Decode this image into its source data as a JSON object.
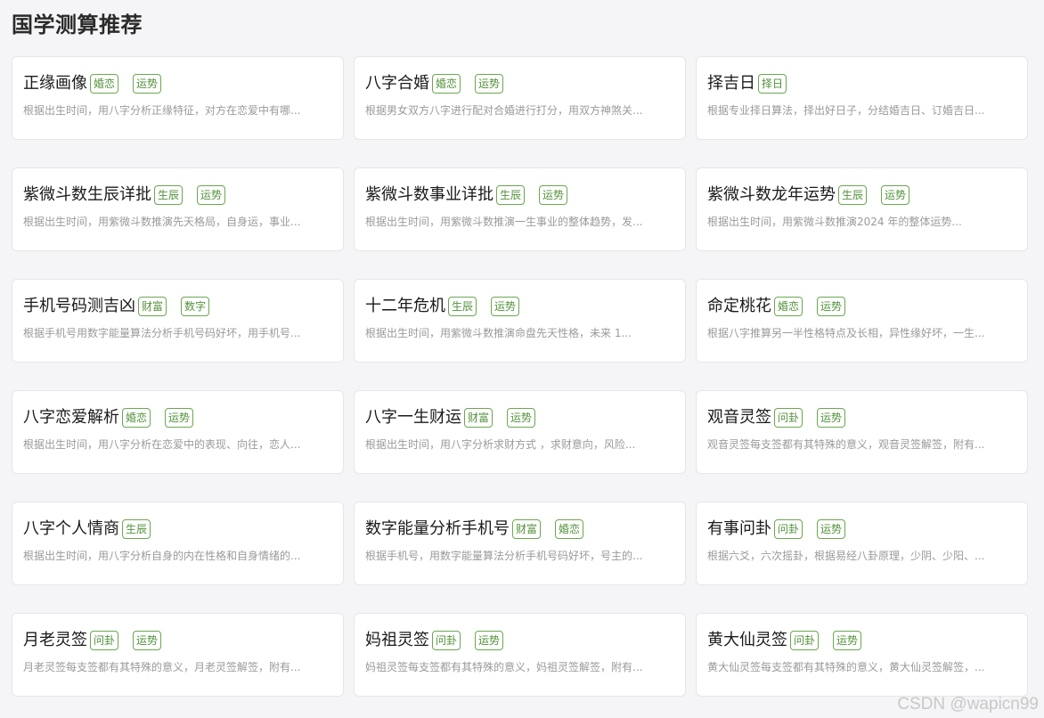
{
  "page": {
    "title": "国学测算推荐",
    "watermark": "CSDN @wapicn99"
  },
  "cards": [
    {
      "title": "正缘画像",
      "tags": [
        "婚恋",
        "运势"
      ],
      "desc": "根据出生时间，用八字分析正缘特征，对方在恋爱中有哪..."
    },
    {
      "title": "八字合婚",
      "tags": [
        "婚恋",
        "运势"
      ],
      "desc": "根据男女双方八字进行配对合婚进行打分，用双方神煞关..."
    },
    {
      "title": "择吉日",
      "tags": [
        "择日"
      ],
      "desc": "根据专业择日算法，择出好日子，分结婚吉日、订婚吉日..."
    },
    {
      "title": "紫微斗数生辰详批",
      "tags": [
        "生辰",
        "运势"
      ],
      "desc": "根据出生时间，用紫微斗数推演先天格局，自身运，事业..."
    },
    {
      "title": "紫微斗数事业详批",
      "tags": [
        "生辰",
        "运势"
      ],
      "desc": "根据出生时间，用紫微斗数推演一生事业的整体趋势，发..."
    },
    {
      "title": "紫微斗数龙年运势",
      "tags": [
        "生辰",
        "运势"
      ],
      "desc": "根据出生时间，用紫微斗数推演2024 年的整体运势..."
    },
    {
      "title": "手机号码测吉凶",
      "tags": [
        "财富",
        "数字"
      ],
      "desc": "根据手机号用数字能量算法分析手机号码好坏，用手机号..."
    },
    {
      "title": "十二年危机",
      "tags": [
        "生辰",
        "运势"
      ],
      "desc": "根据出生时间，用紫微斗数推演命盘先天性格，未来 1..."
    },
    {
      "title": "命定桃花",
      "tags": [
        "婚恋",
        "运势"
      ],
      "desc": "根据八字推算另一半性格特点及长相，异性缘好坏，一生..."
    },
    {
      "title": "八字恋爱解析",
      "tags": [
        "婚恋",
        "运势"
      ],
      "desc": "根据出生时间，用八字分析在恋爱中的表现、向往，恋人..."
    },
    {
      "title": "八字一生财运",
      "tags": [
        "财富",
        "运势"
      ],
      "desc": "根据出生时间，用八字分析求财方式 ，求财意向，风险..."
    },
    {
      "title": "观音灵签",
      "tags": [
        "问卦",
        "运势"
      ],
      "desc": "观音灵签每支签都有其特殊的意义，观音灵签解签，附有..."
    },
    {
      "title": "八字个人情商",
      "tags": [
        "生辰"
      ],
      "desc": "根据出生时间，用八字分析自身的内在性格和自身情绪的..."
    },
    {
      "title": "数字能量分析手机号",
      "tags": [
        "财富",
        "婚恋"
      ],
      "desc": "根据手机号，用数字能量算法分析手机号码好坏，号主的..."
    },
    {
      "title": "有事问卦",
      "tags": [
        "问卦",
        "运势"
      ],
      "desc": "根据六爻，六次摇卦，根据易经八卦原理，少阴、少阳、..."
    },
    {
      "title": "月老灵签",
      "tags": [
        "问卦",
        "运势"
      ],
      "desc": "月老灵签每支签都有其特殊的意义，月老灵签解签，附有..."
    },
    {
      "title": "妈祖灵签",
      "tags": [
        "问卦",
        "运势"
      ],
      "desc": "妈祖灵签每支签都有其特殊的意义，妈祖灵签解签，附有..."
    },
    {
      "title": "黄大仙灵签",
      "tags": [
        "问卦",
        "运势"
      ],
      "desc": "黄大仙灵签每支签都有其特殊的意义，黄大仙灵签解签，..."
    }
  ],
  "colors": {
    "background": "#f5f5f7",
    "card": "#ffffff",
    "tag_text": "#52913a",
    "tag_border": "#6aa84f",
    "desc_text": "#9a9a9a"
  }
}
